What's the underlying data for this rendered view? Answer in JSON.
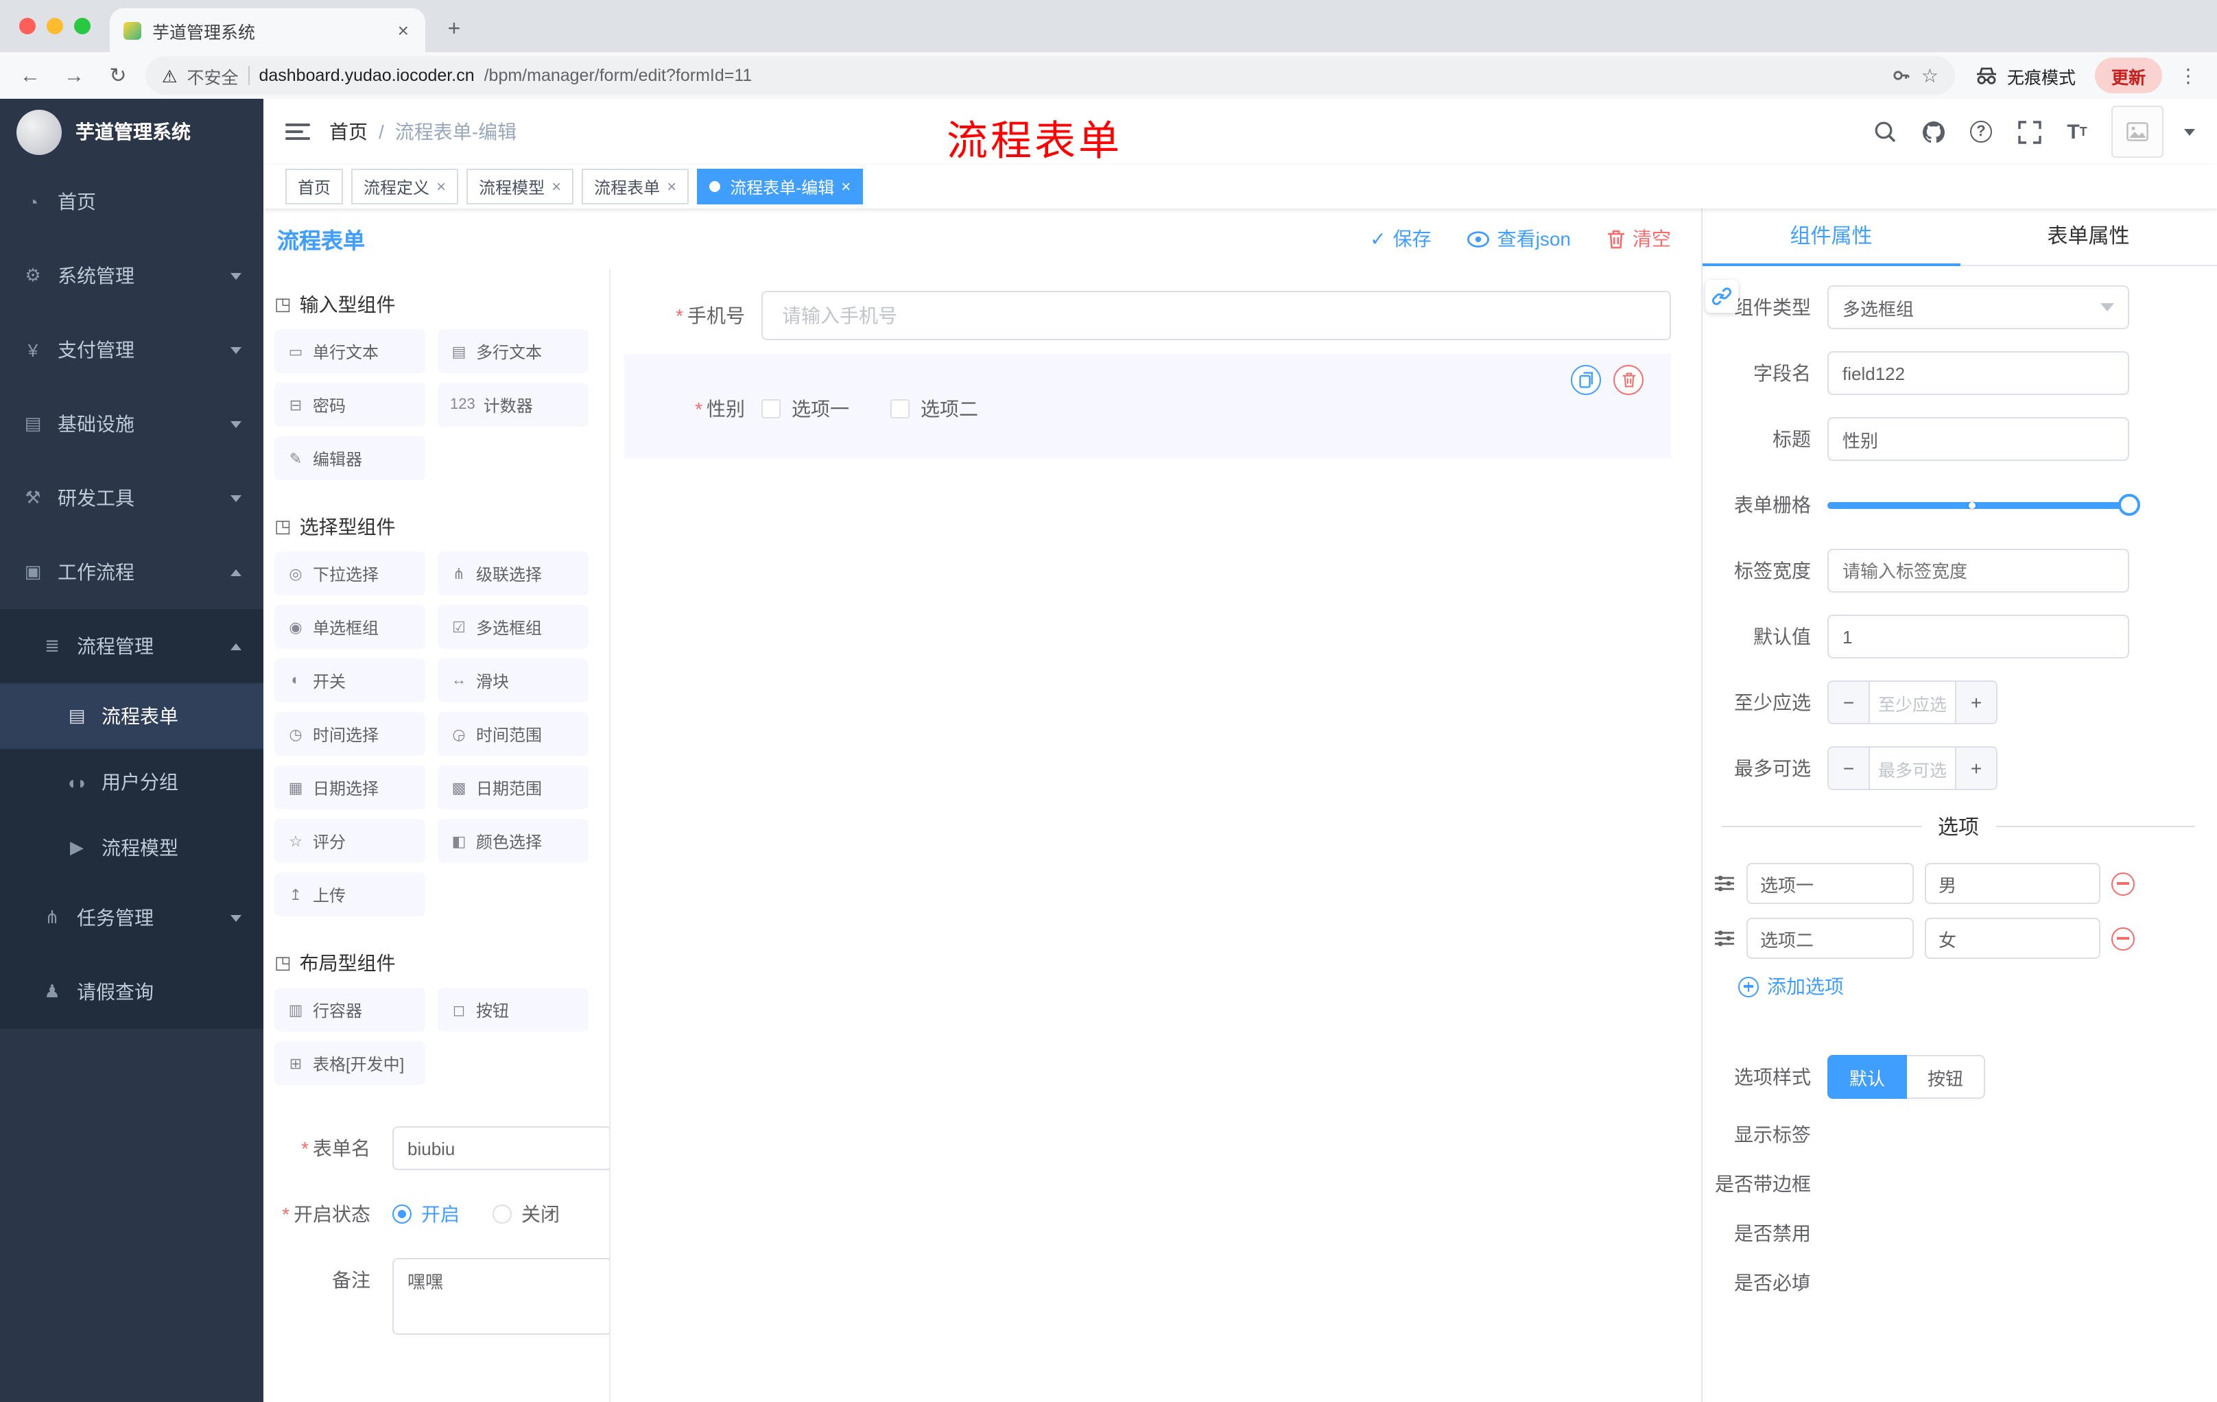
{
  "browser": {
    "tab_title": "芋道管理系统",
    "security_label": "不安全",
    "url_host": "dashboard.yudao.iocoder.cn",
    "url_path": "/bpm/manager/form/edit?formId=11",
    "incognito_label": "无痕模式",
    "update_label": "更新"
  },
  "sidebar": {
    "logo_title": "芋道管理系统",
    "items": [
      {
        "label": "首页",
        "icon": "◔"
      },
      {
        "label": "系统管理",
        "icon": "⚙"
      },
      {
        "label": "支付管理",
        "icon": "¥"
      },
      {
        "label": "基础设施",
        "icon": "▤"
      },
      {
        "label": "研发工具",
        "icon": "⚒"
      },
      {
        "label": "工作流程",
        "icon": "▣"
      },
      {
        "label": "流程管理",
        "icon": "≣"
      },
      {
        "label": "流程表单",
        "icon": "▤"
      },
      {
        "label": "用户分组",
        "icon": "◖◗"
      },
      {
        "label": "流程模型",
        "icon": "▶"
      },
      {
        "label": "任务管理",
        "icon": "⋔"
      },
      {
        "label": "请假查询",
        "icon": "♟"
      }
    ]
  },
  "header": {
    "breadcrumb_home": "首页",
    "breadcrumb_separator": "/",
    "breadcrumb_current": "流程表单-编辑",
    "annotation": "流程表单"
  },
  "tags": [
    {
      "label": "首页"
    },
    {
      "label": "流程定义"
    },
    {
      "label": "流程模型"
    },
    {
      "label": "流程表单"
    },
    {
      "label": "流程表单-编辑"
    }
  ],
  "designer": {
    "title": "流程表单",
    "save": "保存",
    "view_json": "查看json",
    "clear": "清空"
  },
  "palette": {
    "sections": [
      {
        "title": "输入型组件",
        "items": [
          {
            "label": "单行文本",
            "icon": "▭"
          },
          {
            "label": "多行文本",
            "icon": "▤"
          },
          {
            "label": "密码",
            "icon": "⊟"
          },
          {
            "label": "计数器",
            "icon": "123"
          },
          {
            "label": "编辑器",
            "icon": "✎"
          }
        ]
      },
      {
        "title": "选择型组件",
        "items": [
          {
            "label": "下拉选择",
            "icon": "◎"
          },
          {
            "label": "级联选择",
            "icon": "⋔"
          },
          {
            "label": "单选框组",
            "icon": "◉"
          },
          {
            "label": "多选框组",
            "icon": "☑"
          },
          {
            "label": "开关",
            "icon": "◐"
          },
          {
            "label": "滑块",
            "icon": "↔"
          },
          {
            "label": "时间选择",
            "icon": "◷"
          },
          {
            "label": "时间范围",
            "icon": "◶"
          },
          {
            "label": "日期选择",
            "icon": "▦"
          },
          {
            "label": "日期范围",
            "icon": "▩"
          },
          {
            "label": "评分",
            "icon": "☆"
          },
          {
            "label": "颜色选择",
            "icon": "◧"
          },
          {
            "label": "上传",
            "icon": "↥"
          }
        ]
      },
      {
        "title": "布局型组件",
        "items": [
          {
            "label": "行容器",
            "icon": "▥"
          },
          {
            "label": "按钮",
            "icon": "◻"
          },
          {
            "label": "表格[开发中]",
            "icon": "⊞"
          }
        ]
      }
    ]
  },
  "panel_form": {
    "form_name_label": "表单名",
    "form_name_value": "biubiu",
    "status_label": "开启状态",
    "status_on": "开启",
    "status_off": "关闭",
    "remark_label": "备注",
    "remark_value": "嘿嘿"
  },
  "canvas": {
    "phone_label": "手机号",
    "phone_placeholder": "请输入手机号",
    "gender_label": "性别",
    "gender_option1": "选项一",
    "gender_option2": "选项二"
  },
  "props": {
    "tab_component": "组件属性",
    "tab_form": "表单属性",
    "component_type_label": "组件类型",
    "component_type_value": "多选框组",
    "field_name_label": "字段名",
    "field_name_value": "field122",
    "title_label": "标题",
    "title_value": "性别",
    "grid_label": "表单栅格",
    "tag_width_label": "标签宽度",
    "tag_width_placeholder": "请输入标签宽度",
    "default_label": "默认值",
    "default_value": "1",
    "min_label": "至少应选",
    "min_placeholder": "至少应选",
    "max_label": "最多可选",
    "max_placeholder": "最多可选",
    "options_title": "选项",
    "options": [
      {
        "name": "选项一",
        "value": "男"
      },
      {
        "name": "选项二",
        "value": "女"
      }
    ],
    "add_option": "添加选项",
    "style_label": "选项样式",
    "style_default": "默认",
    "style_button": "按钮",
    "show_label_label": "显示标签",
    "border_label": "是否带边框",
    "disabled_label": "是否禁用",
    "required_label": "是否必填"
  },
  "colors": {
    "primary": "#409eff",
    "danger": "#f56c6c",
    "annotation_red": "#ff0000"
  }
}
